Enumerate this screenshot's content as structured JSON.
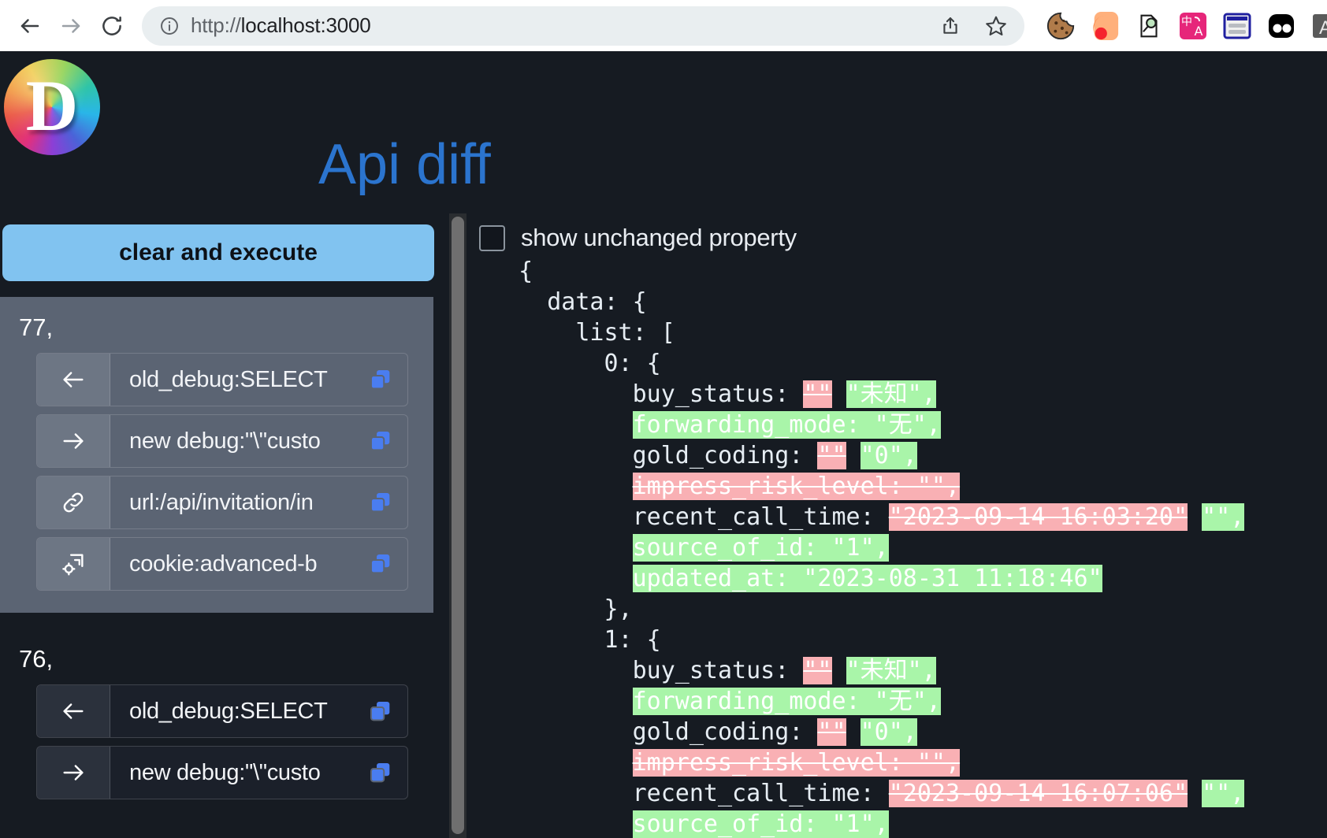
{
  "browser": {
    "back_icon": "back-arrow-icon",
    "forward_icon": "forward-arrow-icon",
    "reload_icon": "reload-icon",
    "site_info_icon": "info-circle-icon",
    "url_scheme": "http://",
    "url_host": "localhost:3000",
    "share_icon": "share-icon",
    "bookmark_icon": "star-icon",
    "extensions": [
      {
        "name": "cookie-extension-icon"
      },
      {
        "name": "color-blob-extension-icon"
      },
      {
        "name": "magnifier-page-extension-icon"
      },
      {
        "name": "translate-extension-icon"
      },
      {
        "name": "reader-list-extension-icon"
      },
      {
        "name": "two-dots-extension-icon"
      },
      {
        "name": "letter-a-extension-icon"
      },
      {
        "name": "cookie-editor-extension-icon"
      },
      {
        "name": "partial-extension-icon"
      }
    ]
  },
  "app": {
    "logo_letter": "D",
    "title": "Api diff",
    "title_color": "#2b74ce",
    "accent_color": "#81c3f0",
    "background_color": "#161b22"
  },
  "sidebar": {
    "execute_button_label": "clear and execute",
    "groups": [
      {
        "index_label": "77,",
        "active": true,
        "rows": [
          {
            "icon": "arrow-left-icon",
            "text": "old_debug:SELECT",
            "copy_icon": "copy-icon"
          },
          {
            "icon": "arrow-right-icon",
            "text": "new debug:\"\\\"custo",
            "copy_icon": "copy-icon"
          },
          {
            "icon": "link-icon",
            "text": "url:/api/invitation/in",
            "copy_icon": "copy-icon"
          },
          {
            "icon": "cookie-settings-icon",
            "text": "cookie:advanced-b",
            "copy_icon": "copy-icon"
          }
        ]
      },
      {
        "index_label": "76,",
        "active": false,
        "rows": [
          {
            "icon": "arrow-left-icon",
            "text": "old_debug:SELECT",
            "copy_icon": "copy-icon"
          },
          {
            "icon": "arrow-right-icon",
            "text": "new debug:\"\\\"custo",
            "copy_icon": "copy-icon"
          }
        ]
      }
    ]
  },
  "diff": {
    "show_unchanged_label": "show unchanged property",
    "show_unchanged_checked": false,
    "delete_color": "#f9b0b4",
    "insert_color": "#a9f5a9",
    "lines": [
      {
        "indent": 1,
        "segments": [
          {
            "t": "{",
            "s": "plain"
          }
        ]
      },
      {
        "indent": 2,
        "segments": [
          {
            "t": "data: {",
            "s": "plain"
          }
        ]
      },
      {
        "indent": 3,
        "segments": [
          {
            "t": "list: [",
            "s": "plain"
          }
        ]
      },
      {
        "indent": 4,
        "segments": [
          {
            "t": "0: {",
            "s": "plain"
          }
        ]
      },
      {
        "indent": 5,
        "segments": [
          {
            "t": "buy_status: ",
            "s": "plain"
          },
          {
            "t": "\"\"",
            "s": "del"
          },
          {
            "t": " ",
            "s": "plain"
          },
          {
            "t": "\"未知\",",
            "s": "ins"
          }
        ]
      },
      {
        "indent": 5,
        "segments": [
          {
            "t": "forwarding_mode: \"无\",",
            "s": "ins"
          }
        ]
      },
      {
        "indent": 5,
        "segments": [
          {
            "t": "gold_coding: ",
            "s": "plain"
          },
          {
            "t": "\"\"",
            "s": "del"
          },
          {
            "t": " ",
            "s": "plain"
          },
          {
            "t": "\"0\",",
            "s": "ins"
          }
        ]
      },
      {
        "indent": 5,
        "segments": [
          {
            "t": "impress_risk_level: \"\",",
            "s": "del"
          }
        ]
      },
      {
        "indent": 5,
        "segments": [
          {
            "t": "recent_call_time: ",
            "s": "plain"
          },
          {
            "t": "\"2023-09-14 16:03:20\"",
            "s": "del"
          },
          {
            "t": " ",
            "s": "plain"
          },
          {
            "t": "\"\",",
            "s": "ins"
          }
        ]
      },
      {
        "indent": 5,
        "segments": [
          {
            "t": "source_of_id: \"1\",",
            "s": "ins"
          }
        ]
      },
      {
        "indent": 5,
        "segments": [
          {
            "t": "updated_at: \"2023-08-31 11:18:46\"",
            "s": "ins"
          }
        ]
      },
      {
        "indent": 4,
        "segments": [
          {
            "t": "},",
            "s": "plain"
          }
        ]
      },
      {
        "indent": 4,
        "segments": [
          {
            "t": "1: {",
            "s": "plain"
          }
        ]
      },
      {
        "indent": 5,
        "segments": [
          {
            "t": "buy_status: ",
            "s": "plain"
          },
          {
            "t": "\"\"",
            "s": "del"
          },
          {
            "t": " ",
            "s": "plain"
          },
          {
            "t": "\"未知\",",
            "s": "ins"
          }
        ]
      },
      {
        "indent": 5,
        "segments": [
          {
            "t": "forwarding_mode: \"无\",",
            "s": "ins"
          }
        ]
      },
      {
        "indent": 5,
        "segments": [
          {
            "t": "gold_coding: ",
            "s": "plain"
          },
          {
            "t": "\"\"",
            "s": "del"
          },
          {
            "t": " ",
            "s": "plain"
          },
          {
            "t": "\"0\",",
            "s": "ins"
          }
        ]
      },
      {
        "indent": 5,
        "segments": [
          {
            "t": "impress_risk_level: \"\",",
            "s": "del"
          }
        ]
      },
      {
        "indent": 5,
        "segments": [
          {
            "t": "recent_call_time: ",
            "s": "plain"
          },
          {
            "t": "\"2023-09-14 16:07:06\"",
            "s": "del"
          },
          {
            "t": " ",
            "s": "plain"
          },
          {
            "t": "\"\",",
            "s": "ins"
          }
        ]
      },
      {
        "indent": 5,
        "segments": [
          {
            "t": "source_of_id: \"1\",",
            "s": "ins"
          }
        ]
      }
    ]
  }
}
